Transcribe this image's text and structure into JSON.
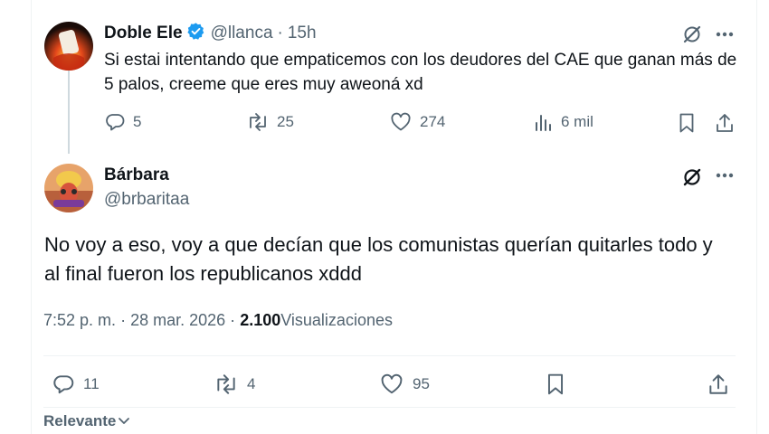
{
  "reply_parent": {
    "display_name": "Doble Ele",
    "handle": "@llanca",
    "separator": "·",
    "time": "15h",
    "text": "Si estai intentando que empaticemos con los deudores del CAE que ganan más de 5 palos, creeme que eres muy aweoná xd",
    "stats": {
      "replies": "5",
      "reposts": "25",
      "likes": "274",
      "views": "6 mil"
    }
  },
  "main_post": {
    "display_name": "Bárbara",
    "handle": "@brbaritaa",
    "text": "No voy a eso, voy a que decían que los comunistas querían quitarles todo y al final fueron los republicanos xddd",
    "time": "7:52 p. m.",
    "separator1": "·",
    "date": "28 mar. 2026",
    "separator2": "·",
    "views_count": "2.100",
    "views_label": "Visualizaciones",
    "stats": {
      "replies": "11",
      "reposts": "4",
      "likes": "95"
    }
  },
  "sort": {
    "label": "Relevante"
  },
  "colors": {
    "accent": "#1d9bf0",
    "muted": "#536471",
    "border": "#eff3f4"
  }
}
